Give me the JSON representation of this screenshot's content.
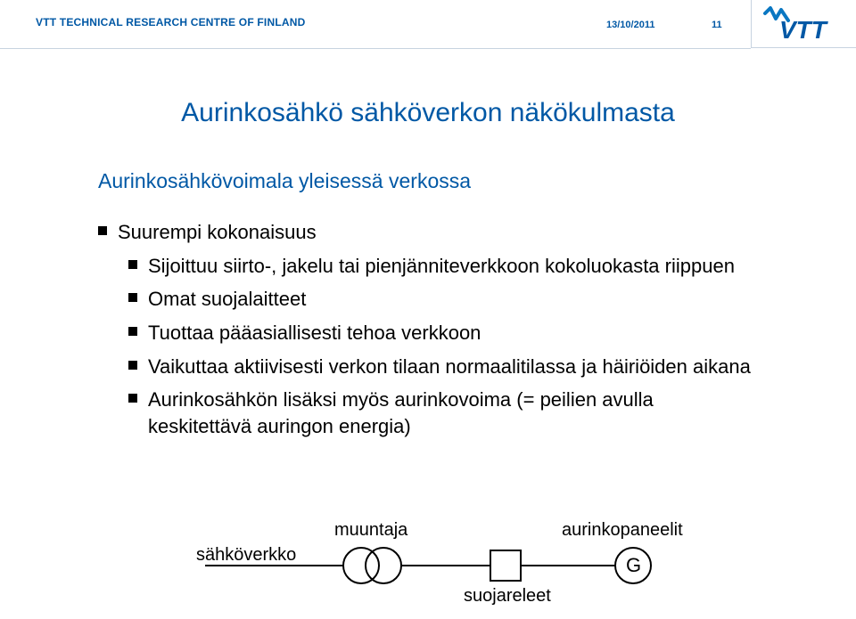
{
  "header": {
    "org": "VTT TECHNICAL RESEARCH CENTRE OF FINLAND",
    "date": "13/10/2011",
    "page": "11",
    "logo_text": "VTT"
  },
  "title": "Aurinkosähkö sähköverkon näkökulmasta",
  "subtitle": "Aurinkosähkövoimala yleisessä verkossa",
  "bullets": [
    {
      "level": 1,
      "text": "Suurempi kokonaisuus"
    },
    {
      "level": 2,
      "text": "Sijoittuu siirto-, jakelu tai pienjänniteverkkoon kokoluokasta riippuen"
    },
    {
      "level": 2,
      "text": "Omat suojalaitteet"
    },
    {
      "level": 2,
      "text": "Tuottaa pääasiallisesti tehoa verkkoon"
    },
    {
      "level": 2,
      "text": "Vaikuttaa aktiivisesti verkon tilaan normaalitilassa ja häiriöiden aikana"
    },
    {
      "level": 2,
      "text": "Aurinkosähkön lisäksi myös aurinkovoima (= peilien avulla keskitettävä auringon energia)"
    }
  ],
  "diagram": {
    "grid_label": "sähköverkko",
    "transformer_label": "muuntaja",
    "relay_label": "suojareleet",
    "panels_label": "aurinkopaneelit",
    "generator_label": "G"
  }
}
